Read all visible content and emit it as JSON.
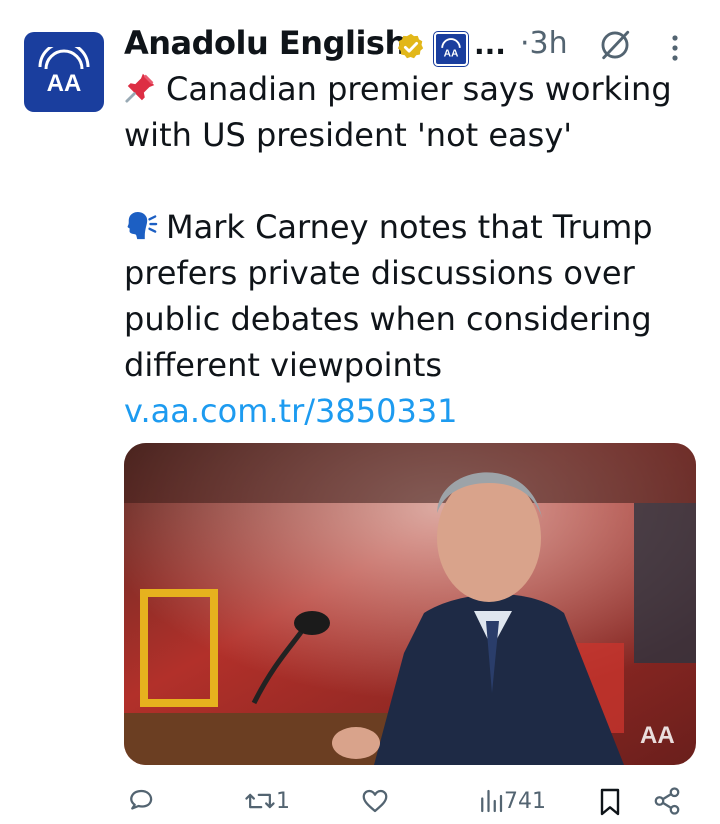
{
  "account": {
    "display_name": "Anadolu English",
    "ellipsis": "...",
    "time_sep": "·",
    "time": "3h",
    "avatar_text": "AA",
    "media_watermark": "AA"
  },
  "tweet": {
    "line1_emoji": "pushpin-icon",
    "headline": "Canadian premier says working with US president 'not easy'",
    "line2_emoji": "speaking-head-icon",
    "body": "Mark Carney notes that Trump prefers private discussions over public debates when considering different viewpoints ",
    "link": "v.aa.com.tr/3850331"
  },
  "actions": {
    "reply_count": "",
    "retweet_count": "1",
    "like_count": "",
    "views_count": "741"
  },
  "colors": {
    "brand": "#1a3e9e",
    "link": "#1d9bf0",
    "muted": "#536471",
    "verified": "#e2b719"
  }
}
